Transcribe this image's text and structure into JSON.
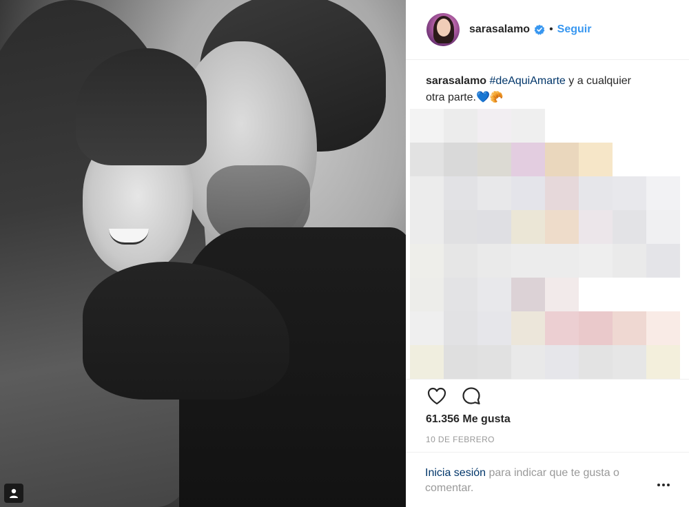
{
  "post": {
    "username": "sarasalamo",
    "verified_icon": "verified-badge-icon",
    "separator": "•",
    "follow_label": "Seguir",
    "caption_username": "sarasalamo",
    "caption_hashtag": "#deAquiAmarte",
    "caption_text_1": " y a cualquier",
    "caption_text_2": "otra parte.",
    "caption_emoji_heart": "💙",
    "caption_emoji_croissant": "🥐",
    "likes": "61.356 Me gusta",
    "date": "10 DE FEBRERO"
  },
  "login_prompt": {
    "link": "Inicia sesión",
    "text": " para indicar que te gusta o comentar."
  },
  "colors": {
    "accent": "#3897f0",
    "link": "#003569",
    "muted": "#999999",
    "text": "#262626"
  }
}
